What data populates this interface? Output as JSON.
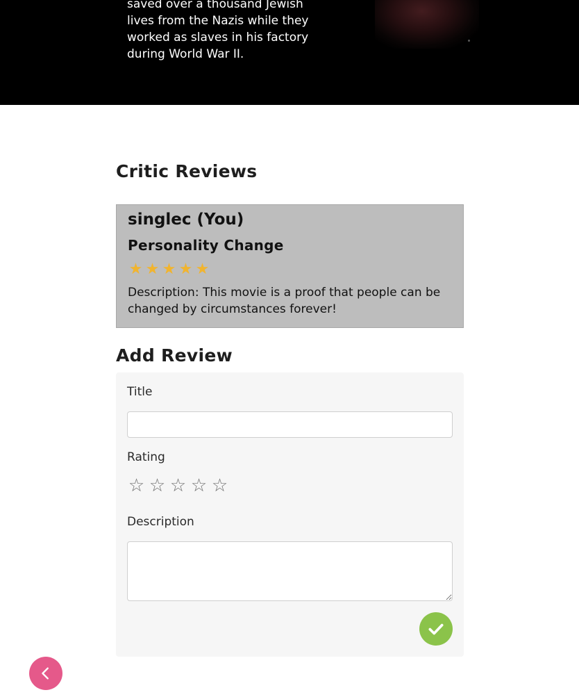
{
  "hero": {
    "synopsis": "saved over a thousand Jewish lives from the Nazis while they worked as slaves in his factory during World War II."
  },
  "critic_reviews": {
    "title": "Critic Reviews",
    "reviews": [
      {
        "user": "singlec (You)",
        "heading": "Personality Change",
        "rating": 5,
        "rating_max": 5,
        "description": "Description: This movie is a proof that people can be changed by circumstances forever!"
      }
    ]
  },
  "add_review": {
    "title": "Add Review",
    "title_label": "Title",
    "title_value": "",
    "rating_label": "Rating",
    "rating_value": 0,
    "rating_max": 5,
    "description_label": "Description",
    "description_value": ""
  },
  "icons": {
    "filled_star": "star-filled-icon",
    "empty_star": "star-outline-icon",
    "submit": "check-icon",
    "back": "chevron-left-icon"
  },
  "colors": {
    "star": "#f1b42f",
    "submit": "#8bc34a",
    "back": "#e5598a",
    "review_card": "#bdbdbd"
  }
}
